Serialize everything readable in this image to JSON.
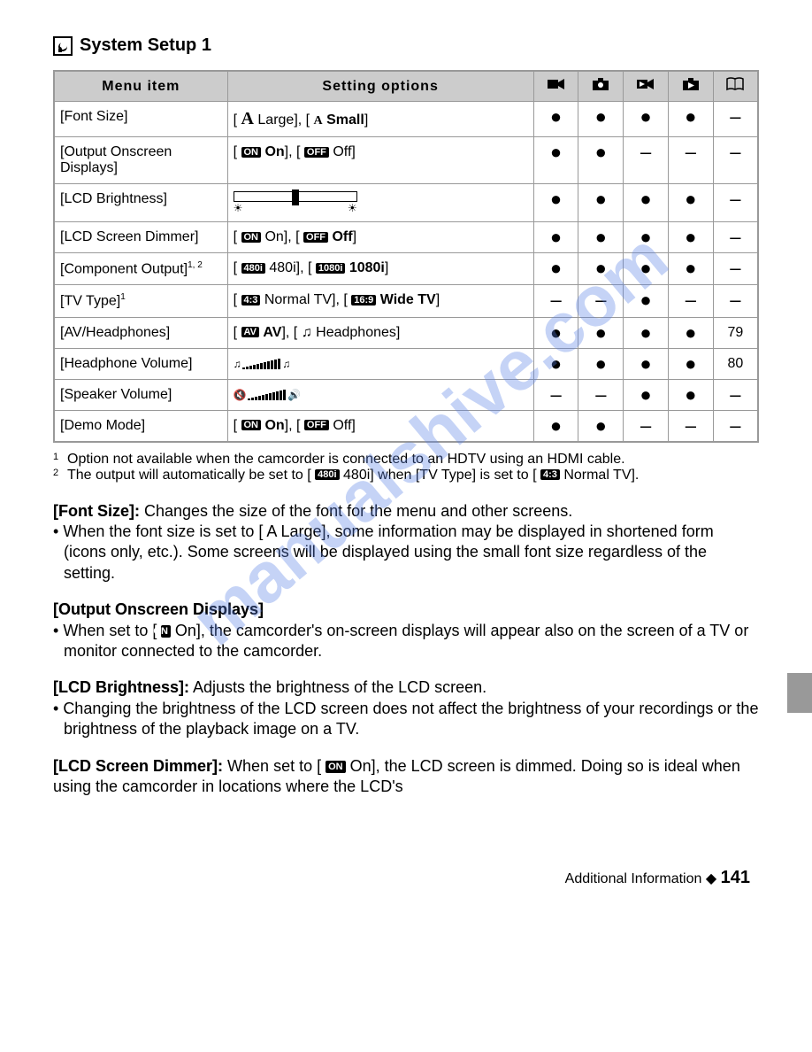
{
  "page_title": "System Setup 1",
  "watermark": "manualshive.com",
  "table": {
    "headers": {
      "menu_item": "Menu item",
      "setting_options": "Setting options"
    },
    "icon_cols": [
      "video-camera-icon",
      "camera-icon",
      "video-play-icon",
      "photo-play-icon",
      "book-icon"
    ],
    "rows": [
      {
        "item": "[Font Size]",
        "options_html": "font_size",
        "marks": [
          "●",
          "●",
          "●",
          "●",
          "–"
        ]
      },
      {
        "item": "[Output Onscreen Displays]",
        "options_html": "on_off_bold_on",
        "marks": [
          "●",
          "●",
          "–",
          "–",
          "–"
        ]
      },
      {
        "item": "[LCD Brightness]",
        "options_html": "slider",
        "marks": [
          "●",
          "●",
          "●",
          "●",
          "–"
        ]
      },
      {
        "item": "[LCD Screen Dimmer]",
        "options_html": "on_off_bold_off",
        "marks": [
          "●",
          "●",
          "●",
          "●",
          "–"
        ]
      },
      {
        "item": "[Component Output]",
        "item_sup": "1, 2",
        "options_html": "component",
        "marks": [
          "●",
          "●",
          "●",
          "●",
          "–"
        ]
      },
      {
        "item": "[TV Type]",
        "item_sup": "1",
        "options_html": "tvtype",
        "marks": [
          "–",
          "–",
          "●",
          "–",
          "–"
        ]
      },
      {
        "item": "[AV/Headphones]",
        "options_html": "avheadphones",
        "marks": [
          "●",
          "●",
          "●",
          "●",
          "79"
        ]
      },
      {
        "item": "[Headphone Volume]",
        "options_html": "vol_headphone",
        "marks": [
          "●",
          "●",
          "●",
          "●",
          "80"
        ]
      },
      {
        "item": "[Speaker Volume]",
        "options_html": "vol_speaker",
        "marks": [
          "–",
          "–",
          "●",
          "●",
          "–"
        ]
      },
      {
        "item": "[Demo Mode]",
        "options_html": "on_off_bold_on",
        "marks": [
          "●",
          "●",
          "–",
          "–",
          "–"
        ]
      }
    ]
  },
  "opt_strings": {
    "large": "Large",
    "small": "Small",
    "on": "On",
    "off": "Off",
    "480i": "480i",
    "1080i": "1080i",
    "normal_tv": "Normal TV",
    "wide_tv": "Wide TV",
    "av": "AV",
    "headphones": "Headphones",
    "box_on": "ON",
    "box_off": "OFF",
    "box_480i": "480i",
    "box_1080i": "1080i",
    "box_43": "4:3",
    "box_169": "16:9",
    "box_av": "AV"
  },
  "footnotes": {
    "f1": "Option not available when the camcorder is connected to an HDTV using an HDMI cable.",
    "f2_pre": "The output will automatically be set to [",
    "f2_mid": " 480i] when [TV Type] is set to [",
    "f2_end": " Normal TV]."
  },
  "body": {
    "font_size_title": "[Font Size]:",
    "font_size_text": " Changes the size of the font for the menu and other screens.",
    "font_size_bullet": "When the font size is set to [ A  Large], some information may be displayed in shortened form (icons only, etc.). Some screens will be displayed using the small font size regardless of the setting.",
    "output_title": "[Output Onscreen Displays]",
    "output_bullet_pre": "When set to [",
    "output_bullet_post": " On], the camcorder's on-screen displays will appear also on the screen of a TV or monitor connected to the camcorder.",
    "lcd_b_title": "[LCD Brightness]:",
    "lcd_b_text": " Adjusts the brightness of the LCD screen.",
    "lcd_b_bullet": "Changing the brightness of the LCD screen does not affect the brightness of your recordings or the brightness of the playback image on a TV.",
    "lcd_d_title": "[LCD Screen Dimmer]:",
    "lcd_d_pre": " When set to [",
    "lcd_d_post": " On], the LCD screen is dimmed. Doing so is ideal when using the camcorder in locations where the LCD's"
  },
  "footer": {
    "section": "Additional Information",
    "diamond": "◆",
    "page": "141"
  }
}
